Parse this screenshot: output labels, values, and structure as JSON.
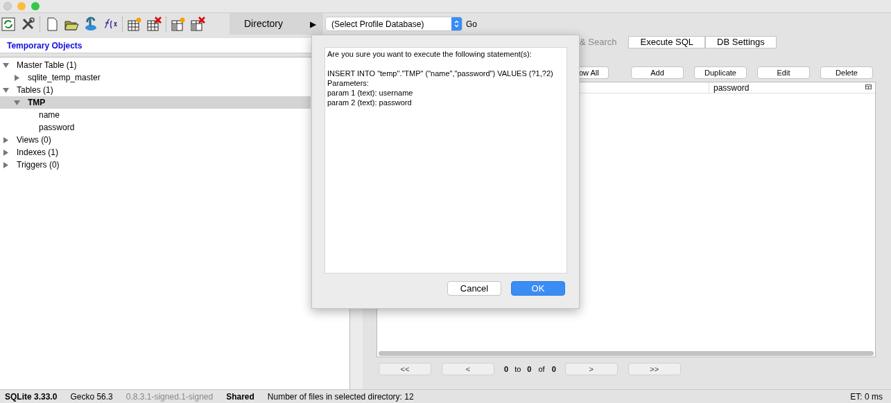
{
  "toolbar": {
    "directory_label": "Directory",
    "directory_arrow": "▶",
    "profile_select": "(Select Profile Database)",
    "go": "Go"
  },
  "sidebar": {
    "title": "Temporary Objects",
    "tree": [
      {
        "label": "Master Table (1)",
        "expanded": true,
        "selected": false,
        "children": [
          {
            "label": "sqlite_temp_master",
            "expanded": false,
            "selected": false
          }
        ]
      },
      {
        "label": "Tables (1)",
        "expanded": true,
        "selected": false,
        "children": [
          {
            "label": "TMP",
            "expanded": true,
            "selected": true,
            "children": [
              {
                "label": "name",
                "selected": false
              },
              {
                "label": "password",
                "selected": false
              }
            ]
          }
        ]
      },
      {
        "label": "Views (0)",
        "expanded": false,
        "selected": false
      },
      {
        "label": "Indexes (1)",
        "expanded": false,
        "selected": false
      },
      {
        "label": "Triggers (0)",
        "expanded": false,
        "selected": false
      }
    ]
  },
  "tabs": [
    {
      "label": "& Search",
      "selected": false,
      "disabled": true
    },
    {
      "label": "Execute SQL",
      "selected": false,
      "disabled": false
    },
    {
      "label": "DB Settings",
      "selected": false,
      "disabled": false
    }
  ],
  "actions": [
    "ow All",
    "Add",
    "Duplicate",
    "Edit",
    "Delete"
  ],
  "table": {
    "columns": [
      "password"
    ]
  },
  "pager": {
    "first": "<<",
    "prev": "<",
    "from": "0",
    "to_label": "to",
    "to": "0",
    "of_label": "of",
    "total": "0",
    "next": ">",
    "last": ">>"
  },
  "dialog": {
    "prompt": "Are you sure you want to execute the following statement(s):",
    "lines": [
      "INSERT INTO \"temp\".\"TMP\" (\"name\",\"password\") VALUES (?1,?2)",
      "Parameters:",
      "param 1 (text): username",
      "param 2 (text): password"
    ],
    "buttons": [
      {
        "label": "Cancel",
        "kind": "normal"
      },
      {
        "label": "OK",
        "kind": "default"
      }
    ]
  },
  "status_bar": [
    {
      "text": "SQLite 3.33.0",
      "kind": "bold"
    },
    {
      "text": "Gecko 56.3",
      "kind": "plain"
    },
    {
      "text": "0.8.3.1-signed.1-signed",
      "kind": "muted"
    },
    {
      "text": "Shared",
      "kind": "bold"
    },
    {
      "text": "Number of files in selected directory: 12",
      "kind": "plain"
    }
  ],
  "status_right": "ET: 0 ms"
}
